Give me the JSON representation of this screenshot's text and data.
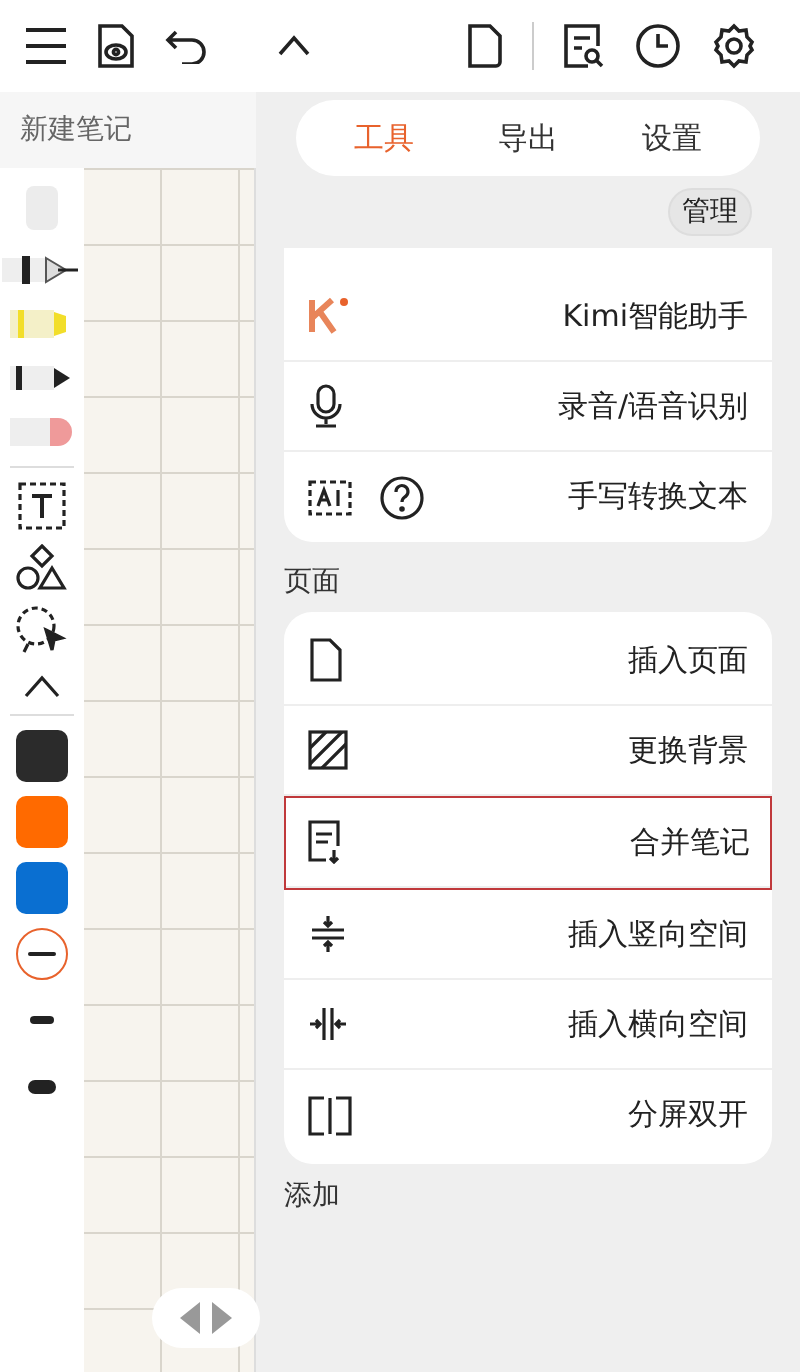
{
  "note_title": "新建笔记",
  "tabs": [
    {
      "label": "工具",
      "selected": true
    },
    {
      "label": "导出",
      "selected": false
    },
    {
      "label": "设置",
      "selected": false
    }
  ],
  "manage_button": "管理",
  "tool_items": [
    {
      "kind": "kimi",
      "label": "Kimi智能助手"
    },
    {
      "kind": "voice",
      "label": "录音/语音识别"
    },
    {
      "kind": "handwriting",
      "label": "手写转换文本"
    }
  ],
  "page_section": {
    "title": "页面",
    "items": [
      {
        "kind": "insert-page",
        "label": "插入页面",
        "highlighted": false
      },
      {
        "kind": "background",
        "label": "更换背景",
        "highlighted": false
      },
      {
        "kind": "merge",
        "label": "合并笔记",
        "highlighted": true
      },
      {
        "kind": "vertical-space",
        "label": "插入竖向空间",
        "highlighted": false
      },
      {
        "kind": "horizontal-space",
        "label": "插入横向空间",
        "highlighted": false
      },
      {
        "kind": "split",
        "label": "分屏双开",
        "highlighted": false
      }
    ]
  },
  "add_section": {
    "title": "添加"
  },
  "pen_colors": [
    {
      "color": "#2b2b2b",
      "selected": false
    },
    {
      "color": "#ff6a00",
      "selected": false
    },
    {
      "color": "#0a6fd1",
      "selected": false
    }
  ],
  "stroke_sizes": [
    {
      "kind": "ring",
      "selected": true
    },
    {
      "kind": "thin",
      "selected": false
    },
    {
      "kind": "thick",
      "selected": false
    }
  ]
}
